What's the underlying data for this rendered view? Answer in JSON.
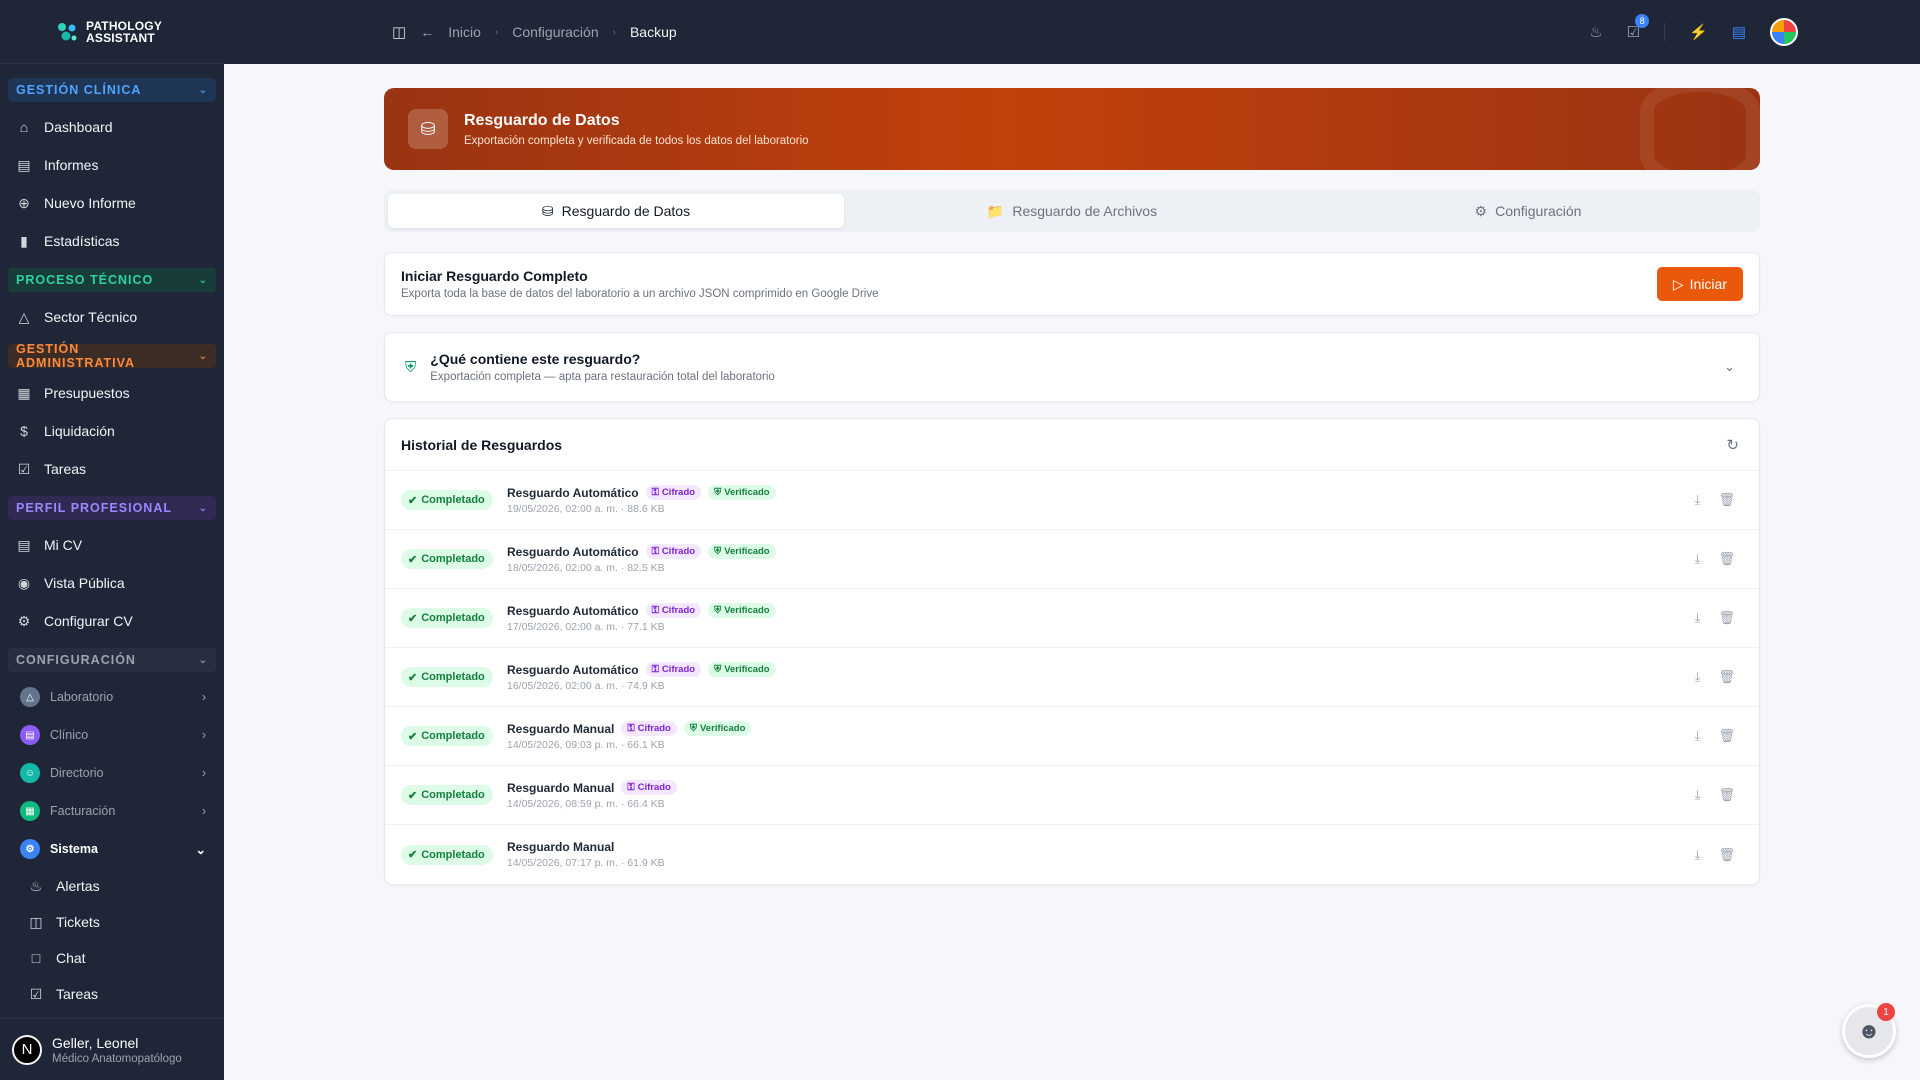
{
  "brand": {
    "line1": "PATHOLOGY",
    "line2": "ASSISTANT"
  },
  "sidebar": {
    "clinica": {
      "header": "GESTIÓN CLÍNICA",
      "items": [
        {
          "label": "Dashboard",
          "icon": "home-icon"
        },
        {
          "label": "Informes",
          "icon": "document-icon"
        },
        {
          "label": "Nuevo Informe",
          "icon": "plus-circle-icon"
        },
        {
          "label": "Estadísticas",
          "icon": "bar-chart-icon"
        }
      ]
    },
    "tecnico": {
      "header": "PROCESO TÉCNICO",
      "items": [
        {
          "label": "Sector Técnico",
          "icon": "flask-icon"
        }
      ]
    },
    "admin": {
      "header": "GESTIÓN ADMINISTRATIVA",
      "items": [
        {
          "label": "Presupuestos",
          "icon": "calculator-icon"
        },
        {
          "label": "Liquidación",
          "icon": "dollar-icon"
        },
        {
          "label": "Tareas",
          "icon": "checkbox-icon"
        }
      ]
    },
    "perfil": {
      "header": "PERFIL PROFESIONAL",
      "items": [
        {
          "label": "Mi CV",
          "icon": "document-icon"
        },
        {
          "label": "Vista Pública",
          "icon": "eye-icon"
        },
        {
          "label": "Configurar CV",
          "icon": "gear-icon"
        }
      ]
    },
    "config": {
      "header": "CONFIGURACIÓN",
      "groups": [
        {
          "label": "Laboratorio"
        },
        {
          "label": "Clínico"
        },
        {
          "label": "Directorio"
        },
        {
          "label": "Facturación"
        },
        {
          "label": "Sistema"
        }
      ],
      "system_items": [
        {
          "label": "Alertas"
        },
        {
          "label": "Tickets"
        },
        {
          "label": "Chat"
        },
        {
          "label": "Tareas"
        }
      ]
    }
  },
  "user": {
    "initial": "N",
    "name": "Geller, Leonel",
    "role": "Médico Anatomopatólogo"
  },
  "topbar": {
    "breadcrumb": [
      "Inicio",
      "Configuración",
      "Backup"
    ],
    "tasks_badge": "8"
  },
  "hero": {
    "title": "Resguardo de Datos",
    "subtitle": "Exportación completa y verificada de todos los datos del laboratorio"
  },
  "tabs": [
    {
      "label": "Resguardo de Datos"
    },
    {
      "label": "Resguardo de Archivos"
    },
    {
      "label": "Configuración"
    }
  ],
  "start_card": {
    "title": "Iniciar Resguardo Completo",
    "subtitle": "Exporta toda la base de datos del laboratorio a un archivo JSON comprimido en Google Drive",
    "button": "Iniciar"
  },
  "info_card": {
    "title": "¿Qué contiene este resguardo?",
    "subtitle": "Exportación completa — apta para restauración total del laboratorio"
  },
  "history": {
    "title": "Historial de Resguardos",
    "tag_encrypted": "Cifrado",
    "tag_verified": "Verificado",
    "rows": [
      {
        "status": "Completado",
        "name": "Resguardo Automático",
        "meta": "19/05/2026, 02:00 a. m. · 88.6 KB",
        "encrypted": true,
        "verified": true
      },
      {
        "status": "Completado",
        "name": "Resguardo Automático",
        "meta": "18/05/2026, 02:00 a. m. · 82.5 KB",
        "encrypted": true,
        "verified": true
      },
      {
        "status": "Completado",
        "name": "Resguardo Automático",
        "meta": "17/05/2026, 02:00 a. m. · 77.1 KB",
        "encrypted": true,
        "verified": true
      },
      {
        "status": "Completado",
        "name": "Resguardo Automático",
        "meta": "16/05/2026, 02:00 a. m. · 74.9 KB",
        "encrypted": true,
        "verified": true
      },
      {
        "status": "Completado",
        "name": "Resguardo Manual",
        "meta": "14/05/2026, 09:03 p. m. · 66.1 KB",
        "encrypted": true,
        "verified": true
      },
      {
        "status": "Completado",
        "name": "Resguardo Manual",
        "meta": "14/05/2026, 08:59 p. m. · 66.4 KB",
        "encrypted": true,
        "verified": false
      },
      {
        "status": "Completado",
        "name": "Resguardo Manual",
        "meta": "14/05/2026, 07:17 p. m. · 61.9 KB",
        "encrypted": false,
        "verified": false
      }
    ]
  },
  "assistant_badge": "1",
  "colors": {
    "accent": "#ea580c",
    "sidebar_bg": "#1e2637",
    "success": "#15803d"
  }
}
